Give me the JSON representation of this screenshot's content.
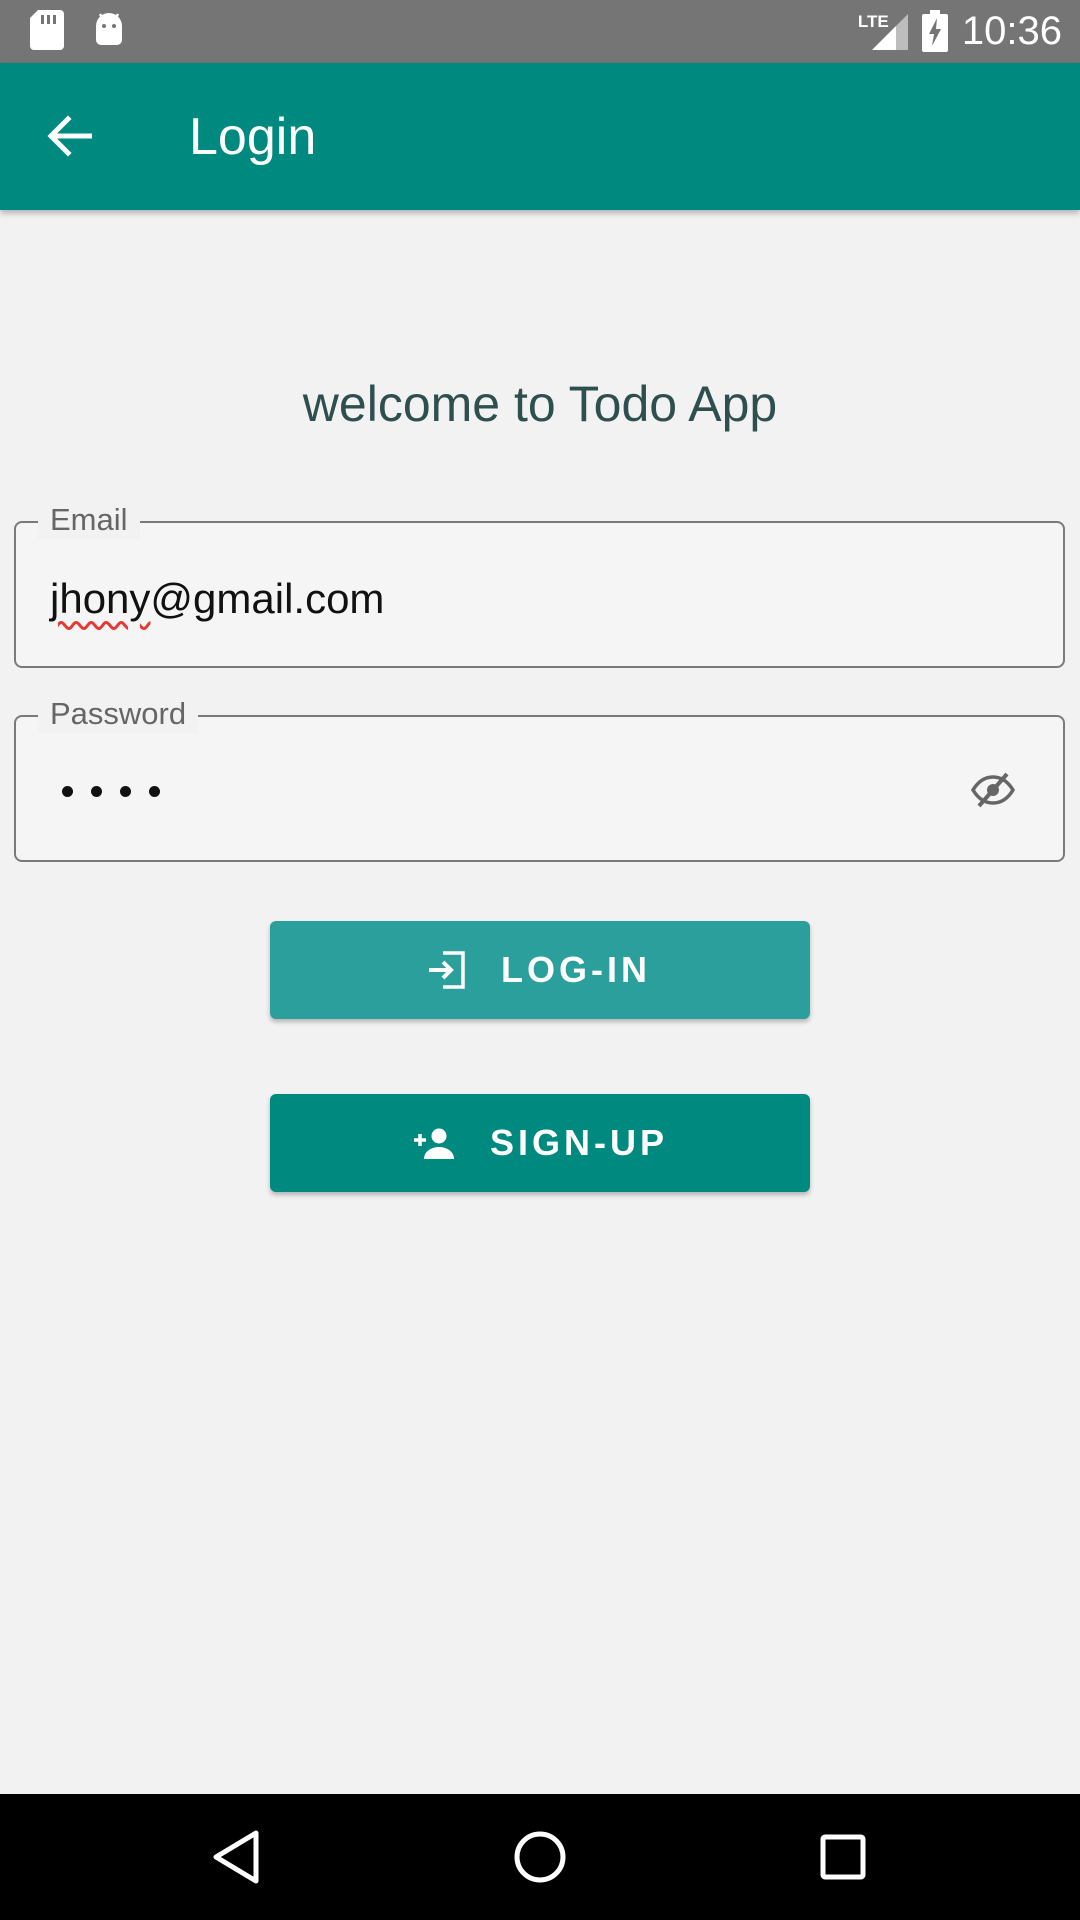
{
  "status_bar": {
    "time": "10:36",
    "network": "LTE"
  },
  "app_bar": {
    "title": "Login"
  },
  "welcome_text": "welcome to Todo App",
  "email_field": {
    "label": "Email",
    "value_misspelled": "jhony",
    "value_rest": "@gmail.com"
  },
  "password_field": {
    "label": "Password",
    "value": "••••"
  },
  "buttons": {
    "login": "LOG-IN",
    "signup": "SIGN-UP"
  },
  "colors": {
    "primary": "#00897f",
    "login_button": "#2a9f9c",
    "status_bar": "#757575",
    "background": "#f2f2f2"
  },
  "icons": {
    "back": "arrow-left-icon",
    "password_toggle": "eye-off-icon",
    "login": "login-icon",
    "signup": "person-add-icon",
    "nav_back": "triangle-back-icon",
    "nav_home": "circle-home-icon",
    "nav_recents": "square-recents-icon"
  }
}
